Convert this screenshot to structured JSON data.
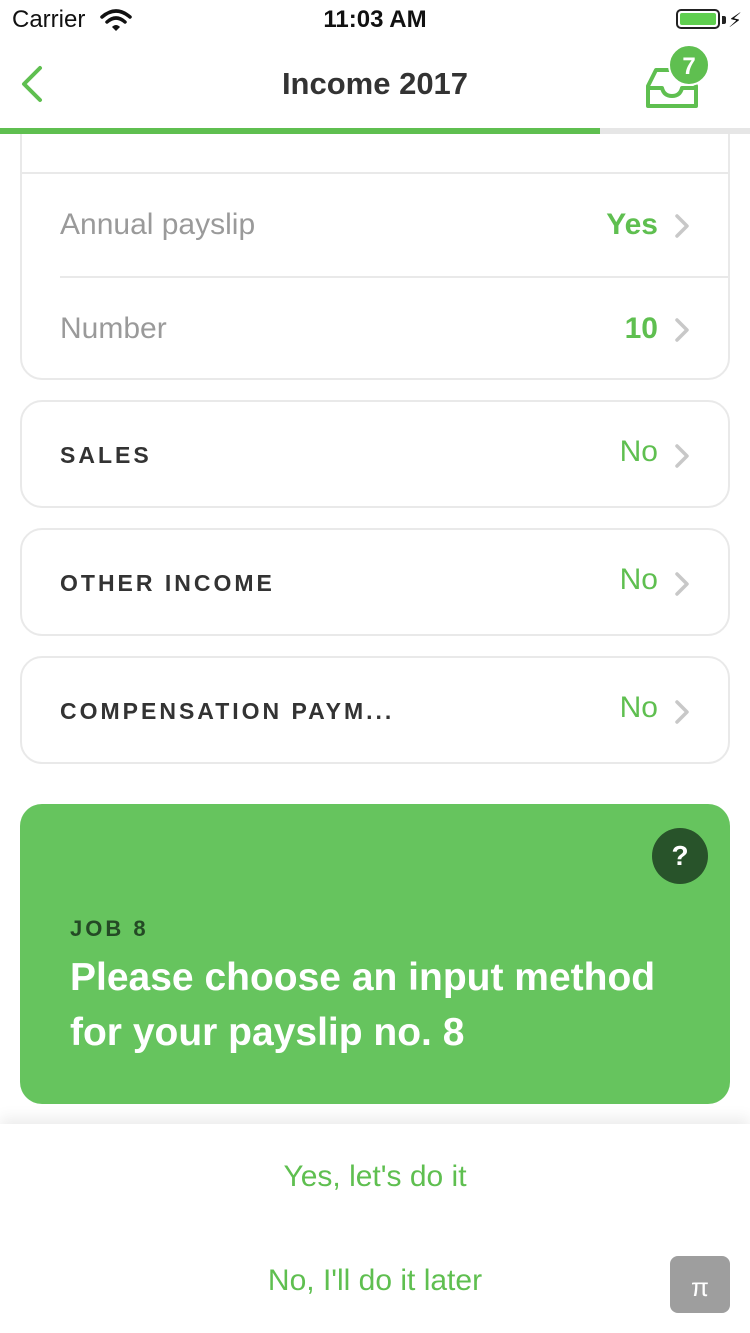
{
  "status_bar": {
    "carrier": "Carrier",
    "time": "11:03 AM",
    "battery_level": 1.0
  },
  "nav": {
    "title": "Income 2017",
    "inbox_badge": "7",
    "progress": 0.8
  },
  "payslip_card": {
    "rows": [
      {
        "label": "Annual payslip",
        "value": "Yes"
      },
      {
        "label": "Number",
        "value": "10"
      }
    ]
  },
  "sections": [
    {
      "label": "SALES",
      "value": "No"
    },
    {
      "label": "OTHER INCOME",
      "value": "No"
    },
    {
      "label": "COMPENSATION PAYM...",
      "value": "No"
    }
  ],
  "job": {
    "label": "JOB 8",
    "text": "Please choose an input method for your payslip no. 8",
    "help": "?"
  },
  "actions": {
    "yes": "Yes, let's do it",
    "no": "No, I'll do it later"
  },
  "pi_button": "π",
  "colors": {
    "accent": "#5fbf50",
    "job_card": "#66c45e",
    "help_button": "#28532a"
  }
}
